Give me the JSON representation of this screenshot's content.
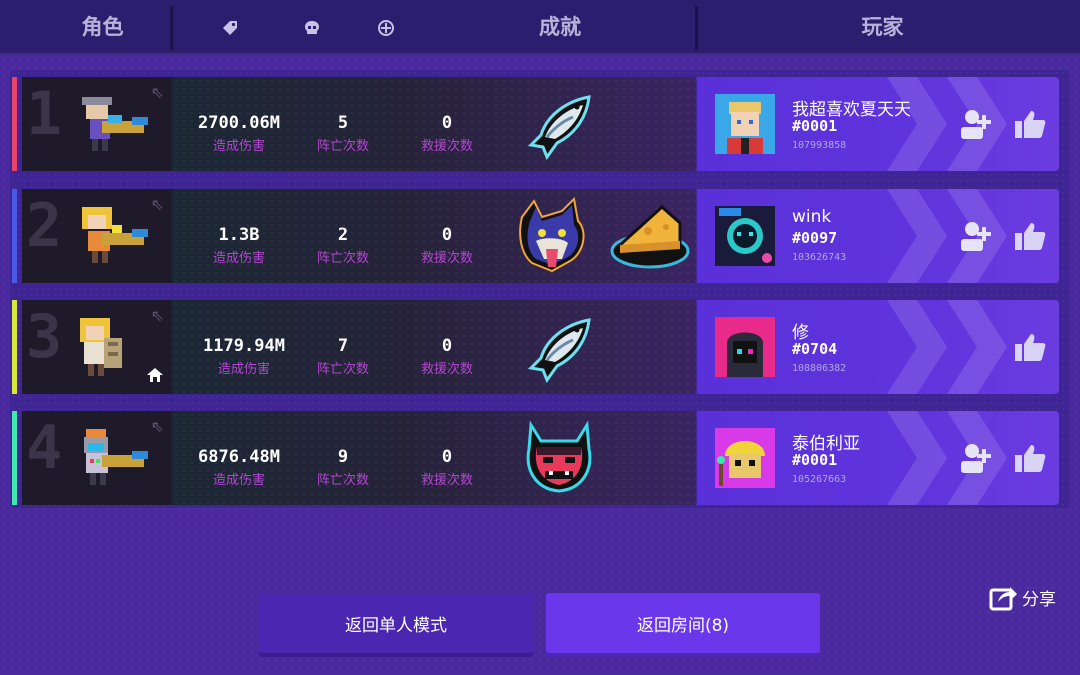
{
  "header": {
    "character_label": "角色",
    "achievement_label": "成就",
    "player_label": "玩家",
    "icons": [
      "tag-icon",
      "skull-icon",
      "crosshair-icon"
    ]
  },
  "rows": [
    {
      "rank": "1",
      "accent_color": "#e8436b",
      "damage": "2700.06M",
      "damage_label": "造成伤害",
      "deaths": "5",
      "deaths_label": "阵亡次数",
      "rescues": "0",
      "rescues_label": "救援次数",
      "badges": [
        "fish-badge"
      ],
      "player_name": "我超喜欢夏天天",
      "player_tag": "#0001",
      "player_id": "107993858",
      "show_add_friend": true,
      "is_host": false
    },
    {
      "rank": "2",
      "accent_color": "#4a5ae8",
      "damage": "1.3B",
      "damage_label": "造成伤害",
      "deaths": "2",
      "deaths_label": "阵亡次数",
      "rescues": "0",
      "rescues_label": "救援次数",
      "badges": [
        "wolf-badge",
        "cheese-badge"
      ],
      "player_name": "wink",
      "player_tag": "#0097",
      "player_id": "103626743",
      "show_add_friend": true,
      "is_host": false
    },
    {
      "rank": "3",
      "accent_color": "#d8e83a",
      "damage": "1179.94M",
      "damage_label": "造成伤害",
      "deaths": "7",
      "deaths_label": "阵亡次数",
      "rescues": "0",
      "rescues_label": "救援次数",
      "badges": [
        "fish-badge"
      ],
      "player_name": "修",
      "player_tag": "#0704",
      "player_id": "108806382",
      "show_add_friend": false,
      "is_host": true
    },
    {
      "rank": "4",
      "accent_color": "#3ee8b0",
      "damage": "6876.48M",
      "damage_label": "造成伤害",
      "deaths": "9",
      "deaths_label": "阵亡次数",
      "rescues": "0",
      "rescues_label": "救援次数",
      "badges": [
        "devil-badge"
      ],
      "player_name": "泰伯利亚",
      "player_tag": "#0001",
      "player_id": "105267663",
      "show_add_friend": true,
      "is_host": false
    }
  ],
  "share_label": "分享",
  "buttons": {
    "single_mode": "返回单人模式",
    "return_room": "返回房间(8)"
  }
}
